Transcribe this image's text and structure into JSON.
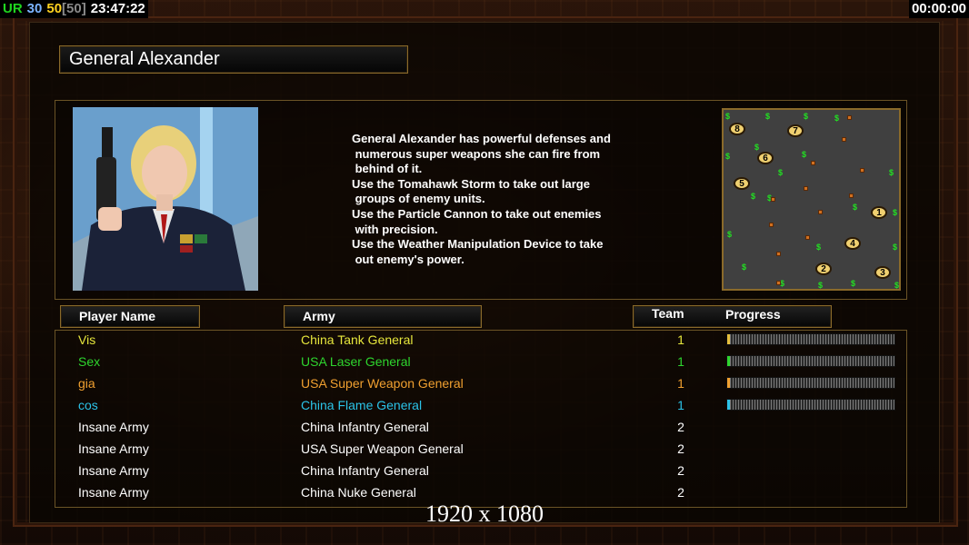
{
  "hud": {
    "mode": "UR",
    "n1": "30",
    "n2": "50",
    "n3": "[50]",
    "clock": "23:47:22",
    "timer": "00:00:00"
  },
  "general": {
    "name": "General Alexander",
    "description": "General Alexander has powerful defenses and\n numerous super weapons she can fire from\n behind of it.\nUse the Tomahawk Storm to take out large\n groups of enemy units.\nUse the Particle Cannon to take out enemies\n with precision.\nUse the Weather Manipulation Device to take\n out enemy's power."
  },
  "minimap": {
    "start_positions": [
      "1",
      "2",
      "3",
      "4",
      "5",
      "6",
      "7",
      "8"
    ],
    "money_symbol": "$"
  },
  "table": {
    "headers": {
      "player": "Player Name",
      "army": "Army",
      "team": "Team",
      "progress": "Progress"
    },
    "rows": [
      {
        "player": "Vis",
        "army": "China Tank General",
        "team": "1",
        "color": "#e6e63c",
        "progress": 0.01,
        "bar_color": "#e6c03c",
        "has_progress": true
      },
      {
        "player": "Sex",
        "army": "USA Laser General",
        "team": "1",
        "color": "#2ed52e",
        "progress": 0.01,
        "bar_color": "#2ed52e",
        "has_progress": true
      },
      {
        "player": "gia",
        "army": "USA Super Weapon General",
        "team": "1",
        "color": "#f0a030",
        "progress": 0.01,
        "bar_color": "#f0a030",
        "has_progress": true
      },
      {
        "player": "cos",
        "army": "China Flame General",
        "team": "1",
        "color": "#2bc3e8",
        "progress": 0.01,
        "bar_color": "#2bc3e8",
        "has_progress": true
      },
      {
        "player": "Insane Army",
        "army": "China Infantry General",
        "team": "2",
        "color": "#ffffff",
        "has_progress": false
      },
      {
        "player": "Insane Army",
        "army": "USA Super Weapon General",
        "team": "2",
        "color": "#ffffff",
        "has_progress": false
      },
      {
        "player": "Insane Army",
        "army": "China Infantry General",
        "team": "2",
        "color": "#ffffff",
        "has_progress": false
      },
      {
        "player": "Insane Army",
        "army": "China Nuke General",
        "team": "2",
        "color": "#ffffff",
        "has_progress": false
      }
    ]
  },
  "caption": "1920 x 1080"
}
